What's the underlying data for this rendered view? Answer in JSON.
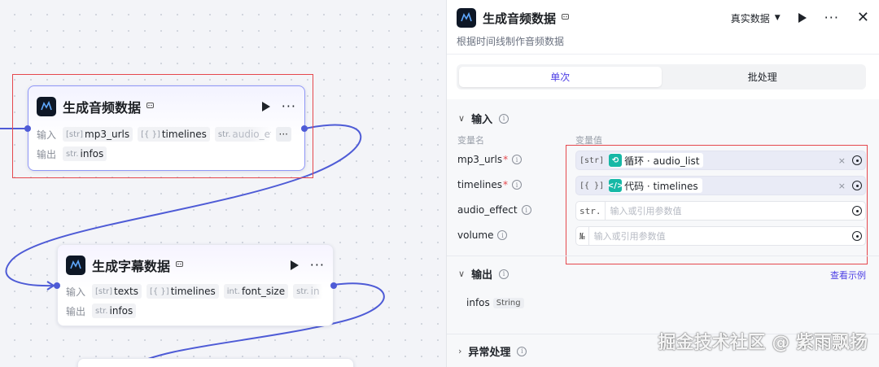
{
  "colors": {
    "accent": "#4e40e5",
    "edge": "#4e5bd6",
    "highlight": "#e5484d",
    "tag_teal": "#16b8a6"
  },
  "canvas": {
    "nodes": [
      {
        "title": "生成音频数据",
        "badge_icon": "bot-icon",
        "input_label": "输入",
        "output_label": "输出",
        "inputs": [
          {
            "type": "[str]",
            "name": "mp3_urls"
          },
          {
            "type": "[{ }]",
            "name": "timelines"
          },
          {
            "type": "str.",
            "name": "audio_effect"
          }
        ],
        "more": "···",
        "outputs": [
          {
            "type": "str.",
            "name": "infos"
          }
        ]
      },
      {
        "title": "生成字幕数据",
        "badge_icon": "bot-icon",
        "input_label": "输入",
        "output_label": "输出",
        "inputs": [
          {
            "type": "[str]",
            "name": "texts"
          },
          {
            "type": "[{ }]",
            "name": "timelines"
          },
          {
            "type": "int.",
            "name": "font_size"
          },
          {
            "type": "str.",
            "name": "in"
          }
        ],
        "outputs": [
          {
            "type": "str.",
            "name": "infos"
          }
        ]
      }
    ]
  },
  "panel": {
    "title": "生成音频数据",
    "description": "根据时间线制作音频数据",
    "mode": "真实数据",
    "tabs": [
      {
        "label": "单次",
        "active": true
      },
      {
        "label": "批处理",
        "active": false
      }
    ],
    "input_section": "输入",
    "col_name": "变量名",
    "col_value": "变量值",
    "params": [
      {
        "name": "mp3_urls",
        "required": true,
        "type": "[str]",
        "tag_icon": "loop-icon",
        "tag_text": "循环 · audio_list",
        "clear": "×"
      },
      {
        "name": "timelines",
        "required": true,
        "type": "[{ }]",
        "tag_icon": "code-icon",
        "tag_text": "代码 · timelines",
        "clear": "×"
      },
      {
        "name": "audio_effect",
        "required": false,
        "type": "str.",
        "placeholder": "输入或引用参数值"
      },
      {
        "name": "volume",
        "required": false,
        "type": "№",
        "placeholder": "输入或引用参数值"
      }
    ],
    "output_section": "输出",
    "view_example": "查看示例",
    "outputs": [
      {
        "name": "infos",
        "type": "String"
      }
    ],
    "exception_section": "异常处理"
  },
  "watermark": "掘金技术社区 @ 紫雨飘扬"
}
